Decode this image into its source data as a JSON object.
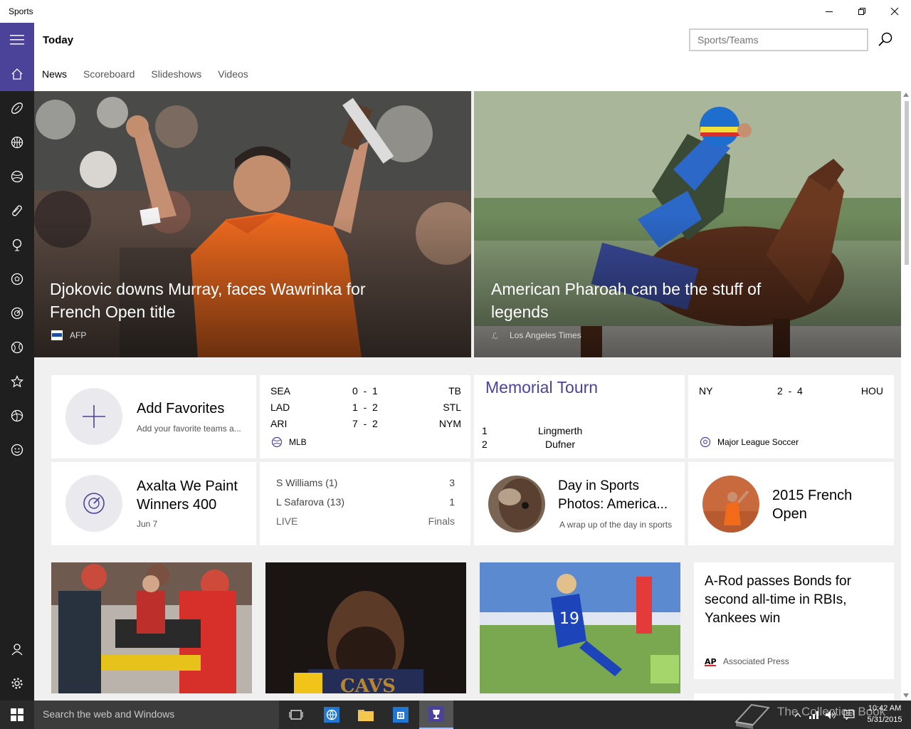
{
  "window": {
    "title": "Sports"
  },
  "header": {
    "page_title": "Today",
    "search_placeholder": "Sports/Teams",
    "tabs": [
      {
        "label": "News",
        "active": true
      },
      {
        "label": "Scoreboard",
        "active": false
      },
      {
        "label": "Slideshows",
        "active": false
      },
      {
        "label": "Videos",
        "active": false
      }
    ]
  },
  "nav": {
    "items": [
      "home-icon",
      "football-icon",
      "basketball-icon",
      "baseball-icon",
      "hockey-icon",
      "golf-icon",
      "soccer-icon",
      "racing-icon",
      "tennis-icon",
      "favorites-icon",
      "more-sports-icon",
      "fantasy-icon"
    ],
    "bottom": [
      "profile-icon",
      "settings-icon"
    ],
    "accent": "#4b4399"
  },
  "hero": [
    {
      "headline": "Djokovic downs Murray, faces Wawrinka for French Open title",
      "source": "AFP"
    },
    {
      "headline": "American Pharoah can be the stuff of legends",
      "source": "Los Angeles Times"
    }
  ],
  "tiles": {
    "add_favorites": {
      "title": "Add Favorites",
      "subtitle": "Add your favorite teams a..."
    },
    "mlb": {
      "rows": [
        {
          "home": "SEA",
          "score": "0  -  1",
          "away": "TB"
        },
        {
          "home": "LAD",
          "score": "1  -  2",
          "away": "STL"
        },
        {
          "home": "ARI",
          "score": "7  -  2",
          "away": "NYM"
        }
      ],
      "league": "MLB"
    },
    "memorial": {
      "title": "Memorial Tourn",
      "rows": [
        {
          "pos": "1",
          "name": "Lingmerth"
        },
        {
          "pos": "2",
          "name": "Dufner"
        }
      ]
    },
    "mls": {
      "home": "NY",
      "score": "2  -  4",
      "away": "HOU",
      "league": "Major League Soccer"
    },
    "nascar": {
      "title": "Axalta We Paint Winners 400",
      "date": "Jun 7"
    },
    "tennis": {
      "rows": [
        {
          "player": "S Williams (1)",
          "score": "3"
        },
        {
          "player": "L Safarova (13)",
          "score": "1"
        }
      ],
      "status": "LIVE",
      "stage": "Finals"
    },
    "day_in_sports": {
      "title": "Day in Sports Photos: America...",
      "subtitle": "A wrap up of the day in sports"
    },
    "french_open": {
      "title": "2015 French Open"
    }
  },
  "bottom_news": {
    "headline": "A-Rod passes Bonds for second all-time in RBIs, Yankees win",
    "source": "Associated Press"
  },
  "taskbar": {
    "search_text": "Search the web and Windows",
    "time": "10:42 AM",
    "date": "5/31/2015",
    "watermark": "The Collection Book"
  }
}
